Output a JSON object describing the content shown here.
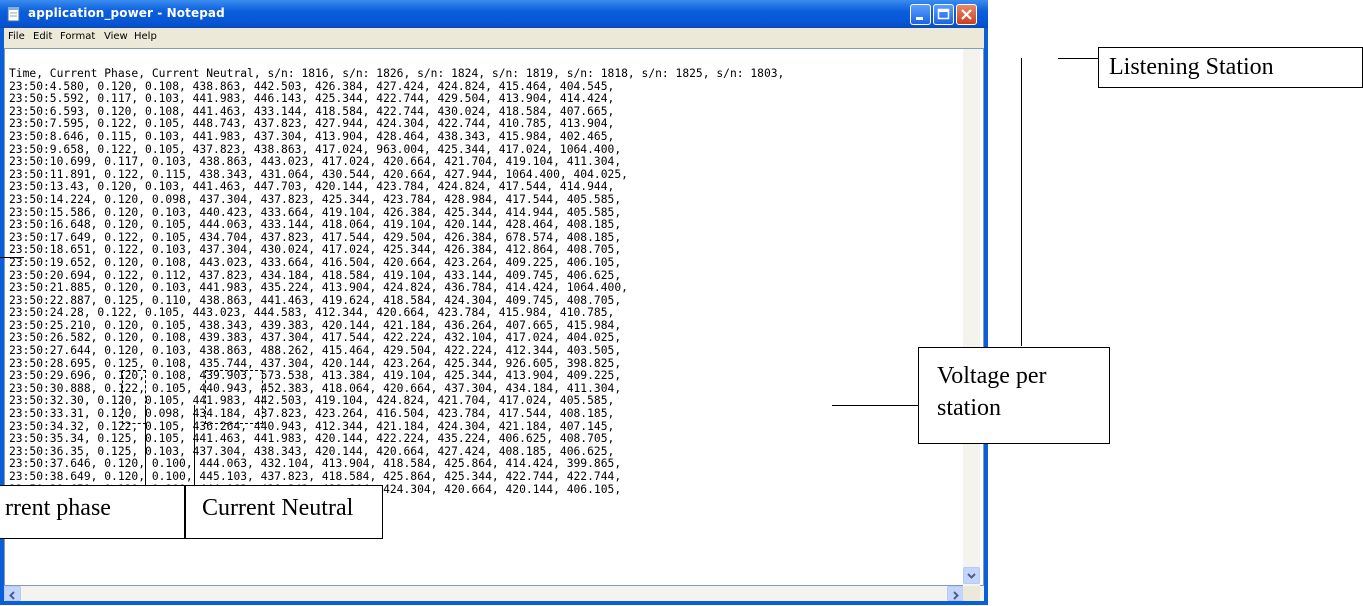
{
  "window": {
    "title": "application_power - Notepad",
    "menu": [
      "File",
      "Edit",
      "Format",
      "View",
      "Help"
    ]
  },
  "document": {
    "lines": [
      "Time, Current Phase, Current Neutral, s/n: 1816, s/n: 1826, s/n: 1824, s/n: 1819, s/n: 1818, s/n: 1825, s/n: 1803,",
      "23:50:4.580, 0.120, 0.108, 438.863, 442.503, 426.384, 427.424, 424.824, 415.464, 404.545,",
      "23:50:5.592, 0.117, 0.103, 441.983, 446.143, 425.344, 422.744, 429.504, 413.904, 414.424,",
      "23:50:6.593, 0.120, 0.108, 441.463, 433.144, 418.584, 422.744, 430.024, 418.584, 407.665,",
      "23:50:7.595, 0.122, 0.105, 448.743, 437.823, 427.944, 424.304, 422.744, 410.785, 413.904,",
      "23:50:8.646, 0.115, 0.103, 441.983, 437.304, 413.904, 428.464, 438.343, 415.984, 402.465,",
      "23:50:9.658, 0.122, 0.105, 437.823, 438.863, 417.024, 963.004, 425.344, 417.024, 1064.400,",
      "23:50:10.699, 0.117, 0.103, 438.863, 443.023, 417.024, 420.664, 421.704, 419.104, 411.304,",
      "23:50:11.891, 0.122, 0.115, 438.343, 431.064, 430.544, 420.664, 427.944, 1064.400, 404.025,",
      "23:50:13.43, 0.120, 0.103, 441.463, 447.703, 420.144, 423.784, 424.824, 417.544, 414.944,",
      "23:50:14.224, 0.120, 0.098, 437.304, 437.823, 425.344, 423.784, 428.984, 417.544, 405.585,",
      "23:50:15.586, 0.120, 0.103, 440.423, 433.664, 419.104, 426.384, 425.344, 414.944, 405.585,",
      "23:50:16.648, 0.120, 0.105, 444.063, 433.144, 418.064, 419.104, 420.144, 428.464, 408.185,",
      "23:50:17.649, 0.122, 0.105, 434.704, 437.823, 417.544, 429.504, 426.384, 678.574, 408.185,",
      "23:50:18.651, 0.122, 0.103, 437.304, 430.024, 417.024, 425.344, 426.384, 412.864, 408.705,",
      "23:50:19.652, 0.120, 0.108, 443.023, 433.664, 416.504, 420.664, 423.264, 409.225, 406.105,",
      "23:50:20.694, 0.122, 0.112, 437.823, 434.184, 418.584, 419.104, 433.144, 409.745, 406.625,",
      "23:50:21.885, 0.120, 0.103, 441.983, 435.224, 413.904, 424.824, 436.784, 414.424, 1064.400,",
      "23:50:22.887, 0.125, 0.110, 438.863, 441.463, 419.624, 418.584, 424.304, 409.745, 408.705,",
      "23:50:24.28, 0.122, 0.105, 443.023, 444.583, 412.344, 420.664, 423.784, 415.984, 410.785,",
      "23:50:25.210, 0.120, 0.105, 438.343, 439.383, 420.144, 421.184, 436.264, 407.665, 415.984,",
      "23:50:26.582, 0.120, 0.108, 439.383, 437.304, 417.544, 422.224, 432.104, 417.024, 404.025,",
      "23:50:27.644, 0.120, 0.103, 438.863, 488.262, 415.464, 429.504, 422.224, 412.344, 403.505,",
      "23:50:28.695, 0.125, 0.108, 435.744, 437.304, 420.144, 423.264, 425.344, 926.605, 398.825,",
      "23:50:29.696, 0.120, 0.108, 439.903, 573.538, 413.384, 419.104, 425.344, 413.904, 409.225,",
      "23:50:30.888, 0.122, 0.105, 440.943, 452.383, 418.064, 420.664, 437.304, 434.184, 411.304,",
      "23:50:32.30, 0.120, 0.105, 441.983, 442.503, 419.104, 424.824, 421.704, 417.024, 405.585,",
      "23:50:33.31, 0.120, 0.098, 434.184, 437.823, 423.264, 416.504, 423.784, 417.544, 408.185,",
      "23:50:34.32, 0.122, 0.105, 436.264, 440.943, 412.344, 421.184, 424.304, 421.184, 407.145,",
      "23:50:35.34, 0.125, 0.105, 441.463, 441.983, 420.144, 422.224, 435.224, 406.625, 408.705,",
      "23:50:36.35, 0.125, 0.103, 437.304, 438.343, 420.144, 420.664, 427.424, 408.185, 406.625,",
      "23:50:37.646, 0.120, 0.100, 444.063, 432.104, 413.904, 418.584, 425.864, 414.424, 399.865,",
      "23:50:38.649, 0.120, 0.100, 445.103, 437.823, 418.584, 425.864, 425.344, 422.744, 422.744,",
      "23:50:39.651, 0.120, 0.100, 444.063, 438.343, 419.104, 424.304, 420.664, 420.144, 406.105,"
    ]
  },
  "annotations": {
    "listening_station": "Listening Station",
    "voltage_line1": "Voltage per",
    "voltage_line2": "station",
    "current_phase": "rrent phase",
    "current_neutral": "Current Neutral"
  }
}
